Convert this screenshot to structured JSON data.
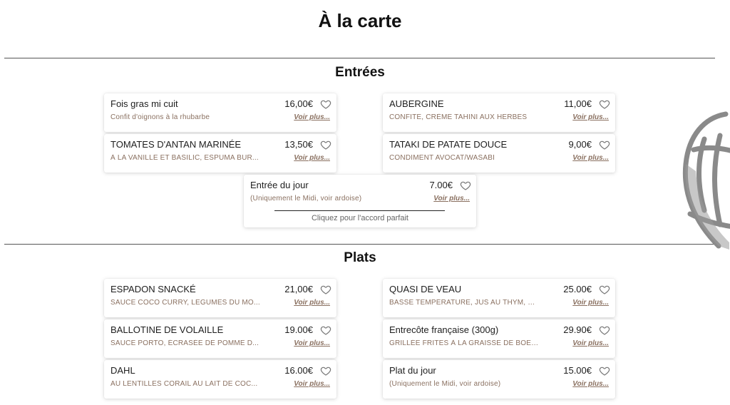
{
  "page": {
    "title": "À la carte"
  },
  "more_label": "Voir plus...",
  "sections": {
    "entrees": {
      "title": "Entrées",
      "items": [
        {
          "name": "Fois gras mi cuit",
          "desc": "Confit d'oignons à la rhubarbe",
          "price": "16,00€"
        },
        {
          "name": "AUBERGINE",
          "desc": "CONFITE, CRÈME TAHINI AUX HERBES",
          "price": "11,00€"
        },
        {
          "name": "TOMATES D'ANTAN MARINÉE",
          "desc": "À LA VANILLE ET BASILIC, ESPUMA BUR...",
          "price": "13,50€"
        },
        {
          "name": "TATAKI DE PATATE DOUCE",
          "desc": "CONDIMENT AVOCAT/WASABI",
          "price": "9,00€"
        },
        {
          "name": "Entrée du jour",
          "desc": "(Uniquement le Midi, voir ardoise)",
          "price": "7.00€",
          "accord": "Cliquez pour l'accord parfait"
        }
      ]
    },
    "plats": {
      "title": "Plats",
      "items": [
        {
          "name": "ESPADON SNACKÉ",
          "desc": "SAUCE COCO CURRY, LEGUMES DU MO...",
          "price": "21,00€"
        },
        {
          "name": "QUASI DE VEAU",
          "desc": "BASSE TEMPÉRATURE, JUS AU THYM, C...",
          "price": "25.00€"
        },
        {
          "name": "BALLOTINE DE VOLAILLE",
          "desc": "SAUCE PORTO, ÉCRASÉE DE POMME D...",
          "price": "19.00€"
        },
        {
          "name": "Entrecôte française (300g)",
          "desc": "GRILLÉE FRITES À LA GRAISSE DE BOEU...",
          "price": "29.90€"
        },
        {
          "name": "DAHL",
          "desc": "AU LENTILLES CORAIL AU LAIT DE COC...",
          "price": "16.00€"
        },
        {
          "name": "Plat du jour",
          "desc": "(Uniquement le Midi, voir ardoise)",
          "price": "15.00€"
        }
      ]
    }
  },
  "icons": {
    "favorite": "heart-outline-icon",
    "decoration": "illustration-decoration"
  },
  "colors": {
    "description": "#8a7060",
    "rule": "#555555",
    "text": "#1e1e1e"
  }
}
